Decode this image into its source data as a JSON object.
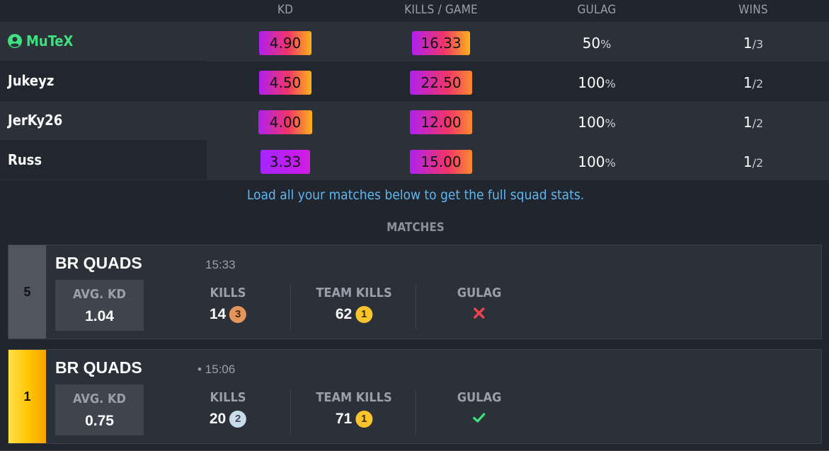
{
  "headers": [
    "KD",
    "KILLS / GAME",
    "GULAG",
    "WINS"
  ],
  "players": [
    {
      "name": "MuTeX",
      "is_me": true,
      "kd": "4.90",
      "kills_per_game": "16.33",
      "gulag_value": "50",
      "gulag_unit": "%",
      "wins_num": "1",
      "wins_den": "/3"
    },
    {
      "name": "Jukeyz",
      "is_me": false,
      "kd": "4.50",
      "kills_per_game": "22.50",
      "gulag_value": "100",
      "gulag_unit": "%",
      "wins_num": "1",
      "wins_den": "/2"
    },
    {
      "name": "JerKy26",
      "is_me": false,
      "kd": "4.00",
      "kills_per_game": "12.00",
      "gulag_value": "100",
      "gulag_unit": "%",
      "wins_num": "1",
      "wins_den": "/2"
    },
    {
      "name": "Russ",
      "is_me": false,
      "kd": "3.33",
      "kills_per_game": "15.00",
      "gulag_value": "100",
      "gulag_unit": "%",
      "wins_num": "1",
      "wins_den": "/2"
    }
  ],
  "note": "Load all your matches below to get the full squad stats.",
  "matches_title": "MATCHES",
  "matches": [
    {
      "placement": "5",
      "mode": "BR QUADS",
      "time": "15:33",
      "avg_kd_label": "AVG. KD",
      "avg_kd": "1.04",
      "kills_label": "KILLS",
      "kills": "14",
      "kills_rank": "3",
      "team_kills_label": "TEAM KILLS",
      "team_kills": "62",
      "team_kills_rank": "1",
      "gulag_label": "GULAG",
      "gulag_result": "lost"
    },
    {
      "placement": "1",
      "mode": "BR QUADS",
      "time": "• 15:06",
      "avg_kd_label": "AVG. KD",
      "avg_kd": "0.75",
      "kills_label": "KILLS",
      "kills": "20",
      "kills_rank": "2",
      "team_kills_label": "TEAM KILLS",
      "team_kills": "71",
      "team_kills_rank": "1",
      "gulag_label": "GULAG",
      "gulag_result": "won"
    }
  ],
  "colors": {
    "me": "#3ee07f",
    "note": "#5fb6f0",
    "gulag_lost": "#f0434d",
    "gulag_won": "#3ee07f",
    "winner": "#ffc400"
  },
  "icons": {
    "me": "user-circle-icon",
    "gulag_lost": "x-icon",
    "gulag_won": "check-icon"
  }
}
